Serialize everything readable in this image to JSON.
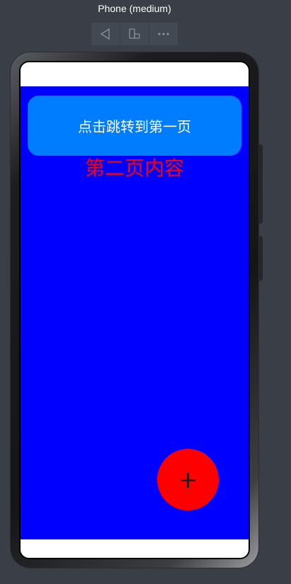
{
  "device": {
    "label": "Phone (medium)"
  },
  "toolbar": {
    "icons": [
      "back-triangle-icon",
      "rotate-device-icon",
      "more-dots-icon"
    ]
  },
  "app": {
    "content_background": "#0000ff",
    "jump_button": {
      "label": "点击跳转到第一页",
      "color": "#007dff"
    },
    "page_text": {
      "label": "第二页内容",
      "color": "#ff0000"
    },
    "fab": {
      "icon": "plus-icon",
      "glyph": "+",
      "color": "#ff0000"
    }
  }
}
